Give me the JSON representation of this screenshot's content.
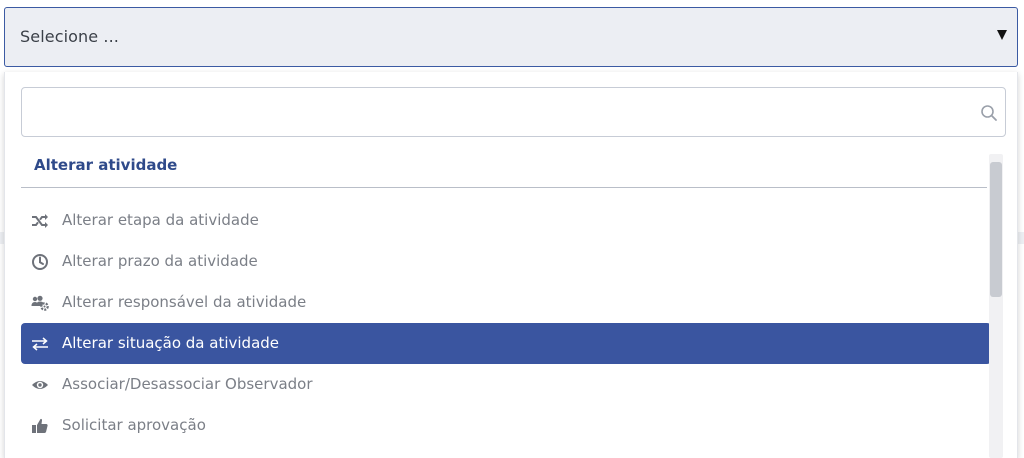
{
  "select": {
    "value": "Selecione ...",
    "caret_icon": "triangle-down-icon"
  },
  "dropdown": {
    "search": {
      "value": "",
      "placeholder": "",
      "icon": "search-icon"
    },
    "group_label": "Alterar atividade",
    "options": [
      {
        "label": "Alterar etapa da atividade",
        "icon": "shuffle-icon",
        "selected": false
      },
      {
        "label": "Alterar prazo da atividade",
        "icon": "clock-icon",
        "selected": false
      },
      {
        "label": "Alterar responsável da atividade",
        "icon": "users-gear-icon",
        "selected": false
      },
      {
        "label": "Alterar situação da atividade",
        "icon": "swap-arrows-icon",
        "selected": true
      },
      {
        "label": "Associar/Desassociar Observador",
        "icon": "eye-icon",
        "selected": false
      },
      {
        "label": "Solicitar aprovação",
        "icon": "thumbs-up-icon",
        "selected": false
      }
    ]
  },
  "colors": {
    "accent": "#3a55a0",
    "border_focus": "#3b5aa3",
    "group_label": "#2f4a8a",
    "option_text": "#7b7f87",
    "icon": "#6e727a"
  }
}
